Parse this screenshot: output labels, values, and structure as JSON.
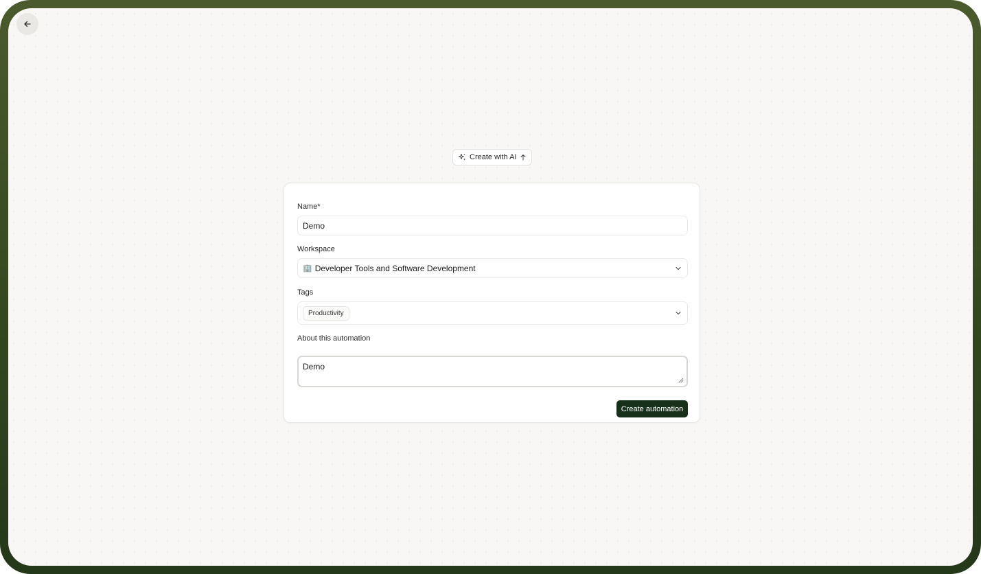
{
  "nav": {
    "back_icon": "arrow-left-icon"
  },
  "ai_button": {
    "label": "Create with AI",
    "left_icon": "sparkles-icon",
    "right_icon": "arrow-up-icon"
  },
  "form": {
    "name": {
      "label": "Name*",
      "value": "Demo"
    },
    "workspace": {
      "label": "Workspace",
      "emoji": "🏢",
      "value": "Developer Tools and Software Development",
      "icon": "chevron-down-icon"
    },
    "tags": {
      "label": "Tags",
      "items": [
        "Productivity"
      ],
      "icon": "chevron-down-icon"
    },
    "about": {
      "label": "About this automation",
      "value": "Demo"
    },
    "submit_label": "Create automation"
  },
  "colors": {
    "frame": "#34481f",
    "background": "#f8f7f5",
    "primary_button": "#17301a"
  }
}
